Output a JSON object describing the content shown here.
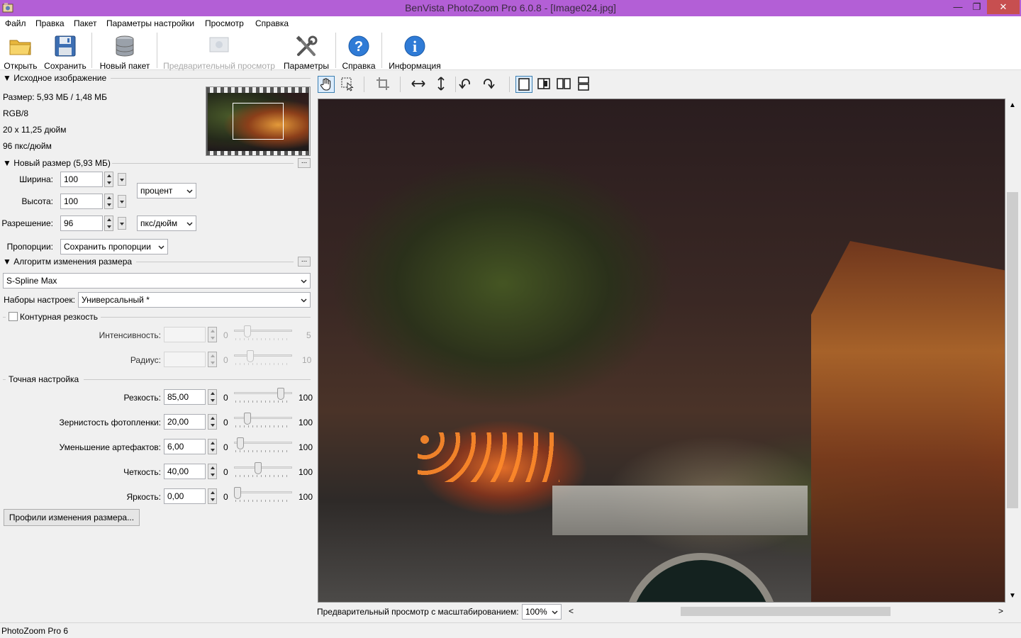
{
  "window": {
    "title": "BenVista PhotoZoom Pro 6.0.8 - [Image024.jpg]",
    "minimize": "—",
    "restore": "❐",
    "close": "✕"
  },
  "menu": [
    "Файл",
    "Правка",
    "Пакет",
    "Параметры настройки",
    "Просмотр",
    "Справка"
  ],
  "toolbar": {
    "open": "Открыть",
    "save": "Сохранить",
    "new_batch": "Новый пакет",
    "preview": "Предварительный просмотр",
    "settings": "Параметры",
    "help": "Справка",
    "info": "Информация"
  },
  "source": {
    "header": "Исходное изображение",
    "size": "Размер: 5,93 МБ / 1,48 МБ",
    "mode": "RGB/8",
    "dimensions": "20 x 11,25 дюйм",
    "dpi": "96 пкс/дюйм"
  },
  "new_size": {
    "header": "Новый размер (5,93 МБ)",
    "width_label": "Ширина:",
    "width_value": "100",
    "height_label": "Высота:",
    "height_value": "100",
    "resolution_label": "Разрешение:",
    "resolution_value": "96",
    "size_unit": "процент",
    "res_unit": "пкс/дюйм",
    "proportions_label": "Пропорции:",
    "proportions_value": "Сохранить пропорции",
    "more": "..."
  },
  "algorithm": {
    "header": "Алгоритм изменения размера",
    "method": "S-Spline Max",
    "presets_label": "Наборы настроек:",
    "presets_value": "Универсальный *",
    "more": "..."
  },
  "edge_sharpness": {
    "label": "Контурная резкость",
    "checked": false,
    "intensity_label": "Интенсивность:",
    "intensity_min": "0",
    "intensity_max": "5",
    "intensity_level": 0.2,
    "radius_label": "Радиус:",
    "radius_min": "0",
    "radius_max": "10",
    "radius_level": 0.25
  },
  "fine_tuning": {
    "header": "Точная настройка",
    "params": [
      {
        "label": "Резкость:",
        "value": "85,00",
        "min": "0",
        "max": "100",
        "level": 0.85
      },
      {
        "label": "Зернистость фотопленки:",
        "value": "20,00",
        "min": "0",
        "max": "100",
        "level": 0.2
      },
      {
        "label": "Уменьшение артефактов:",
        "value": "6,00",
        "min": "0",
        "max": "100",
        "level": 0.06
      },
      {
        "label": "Четкость:",
        "value": "40,00",
        "min": "0",
        "max": "100",
        "level": 0.4
      },
      {
        "label": "Яркость:",
        "value": "0,00",
        "min": "0",
        "max": "100",
        "level": 0.0
      }
    ]
  },
  "profiles_button": "Профили изменения размера...",
  "preview_zoom": {
    "label": "Предварительный просмотр с масштабированием:",
    "value": "100%",
    "left": "<",
    "right": ">"
  },
  "statusbar": {
    "text": "PhotoZoom Pro 6"
  },
  "colors": {
    "titlebar": "#b35fd6",
    "active_tool": "#dcecfc",
    "active_border": "#3c7fb1"
  },
  "icons": {
    "open": "folder-icon",
    "save": "floppy-disk-icon",
    "new_batch": "database-icon",
    "preview": "preview-icon",
    "settings": "tools-icon",
    "help": "question-icon",
    "info": "info-icon"
  }
}
